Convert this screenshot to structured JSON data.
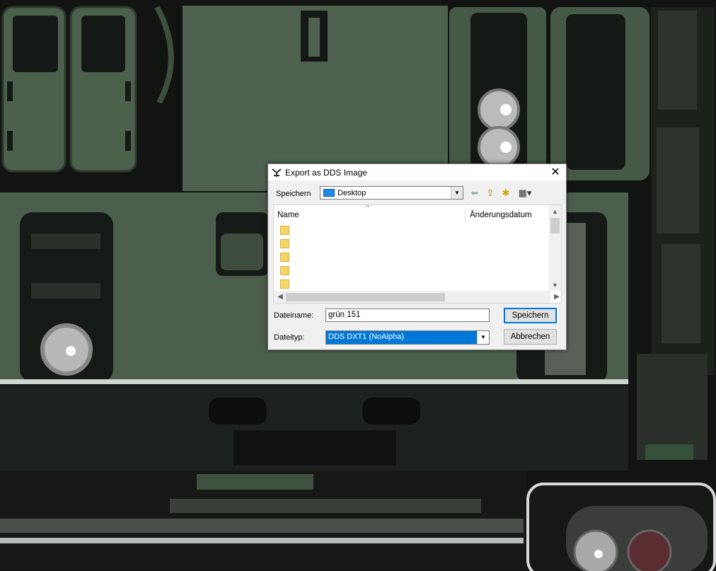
{
  "dialog": {
    "title": "Export as DDS Image",
    "close_symbol": "✕",
    "save_in_label": "Speichern",
    "location": "Desktop",
    "toolbar_icons": [
      "back-arrow-icon",
      "up-folder-icon",
      "new-folder-icon",
      "view-menu-icon"
    ],
    "columns": {
      "name": "Name",
      "date": "Änderungsdatum"
    },
    "folder_count": 5,
    "filename_label": "Dateiname:",
    "filename_value": "grün 151",
    "filetype_label": "Dateityp:",
    "filetype_value": "DDS DXT1 (NoAlpha)",
    "save_button": "Speichern",
    "cancel_button": "Abbrechen"
  },
  "colors": {
    "panel_green": "#4a5e4a",
    "dark_background": "#111411",
    "dialog_bg": "#f0f0f0",
    "selection": "#0078d7"
  }
}
